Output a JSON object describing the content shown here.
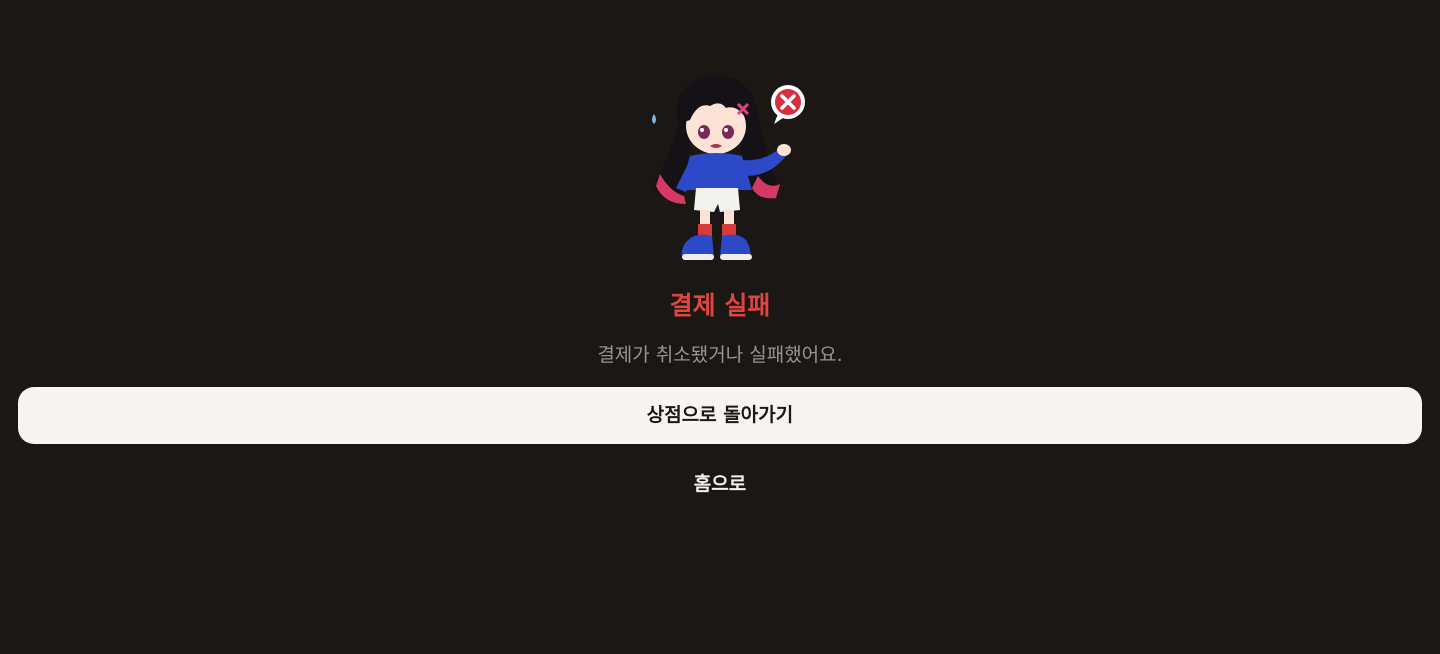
{
  "result": {
    "title": "결제 실패",
    "message": "결제가 취소됐거나 실패했어요.",
    "status_color": "#e0453f"
  },
  "actions": {
    "back_to_shop_label": "상점으로 돌아가기",
    "home_label": "홈으로"
  },
  "illustration": {
    "icon": "failed-payment-mascot-icon",
    "badge_icon": "error-x-speech-bubble-icon"
  },
  "colors": {
    "background": "#1b1714",
    "primary_button_bg": "#f6f5f3",
    "message_text": "#9a9390"
  }
}
